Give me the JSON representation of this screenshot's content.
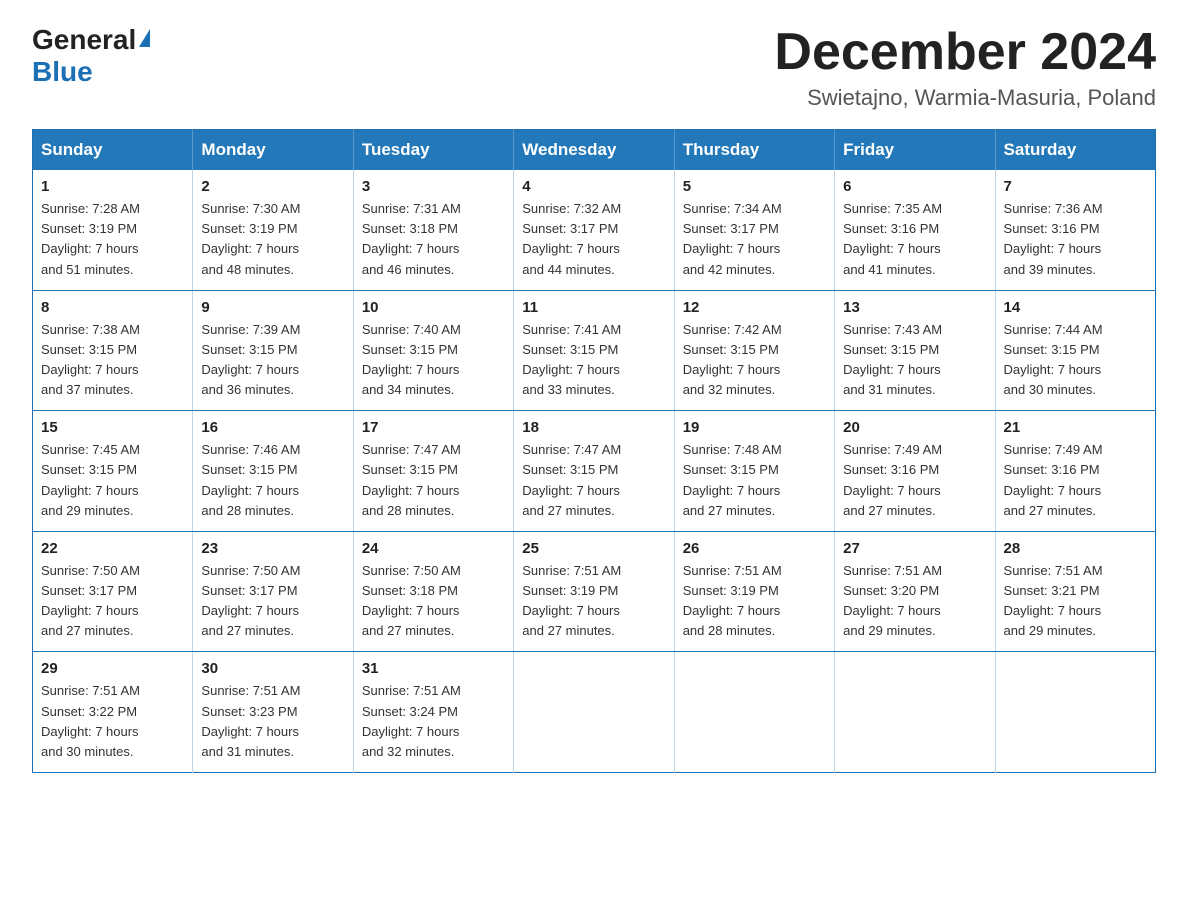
{
  "header": {
    "logo_general": "General",
    "logo_blue": "Blue",
    "month_title": "December 2024",
    "subtitle": "Swietajno, Warmia-Masuria, Poland"
  },
  "days_of_week": [
    "Sunday",
    "Monday",
    "Tuesday",
    "Wednesday",
    "Thursday",
    "Friday",
    "Saturday"
  ],
  "weeks": [
    [
      {
        "day": "1",
        "sunrise": "7:28 AM",
        "sunset": "3:19 PM",
        "daylight": "7 hours and 51 minutes."
      },
      {
        "day": "2",
        "sunrise": "7:30 AM",
        "sunset": "3:19 PM",
        "daylight": "7 hours and 48 minutes."
      },
      {
        "day": "3",
        "sunrise": "7:31 AM",
        "sunset": "3:18 PM",
        "daylight": "7 hours and 46 minutes."
      },
      {
        "day": "4",
        "sunrise": "7:32 AM",
        "sunset": "3:17 PM",
        "daylight": "7 hours and 44 minutes."
      },
      {
        "day": "5",
        "sunrise": "7:34 AM",
        "sunset": "3:17 PM",
        "daylight": "7 hours and 42 minutes."
      },
      {
        "day": "6",
        "sunrise": "7:35 AM",
        "sunset": "3:16 PM",
        "daylight": "7 hours and 41 minutes."
      },
      {
        "day": "7",
        "sunrise": "7:36 AM",
        "sunset": "3:16 PM",
        "daylight": "7 hours and 39 minutes."
      }
    ],
    [
      {
        "day": "8",
        "sunrise": "7:38 AM",
        "sunset": "3:15 PM",
        "daylight": "7 hours and 37 minutes."
      },
      {
        "day": "9",
        "sunrise": "7:39 AM",
        "sunset": "3:15 PM",
        "daylight": "7 hours and 36 minutes."
      },
      {
        "day": "10",
        "sunrise": "7:40 AM",
        "sunset": "3:15 PM",
        "daylight": "7 hours and 34 minutes."
      },
      {
        "day": "11",
        "sunrise": "7:41 AM",
        "sunset": "3:15 PM",
        "daylight": "7 hours and 33 minutes."
      },
      {
        "day": "12",
        "sunrise": "7:42 AM",
        "sunset": "3:15 PM",
        "daylight": "7 hours and 32 minutes."
      },
      {
        "day": "13",
        "sunrise": "7:43 AM",
        "sunset": "3:15 PM",
        "daylight": "7 hours and 31 minutes."
      },
      {
        "day": "14",
        "sunrise": "7:44 AM",
        "sunset": "3:15 PM",
        "daylight": "7 hours and 30 minutes."
      }
    ],
    [
      {
        "day": "15",
        "sunrise": "7:45 AM",
        "sunset": "3:15 PM",
        "daylight": "7 hours and 29 minutes."
      },
      {
        "day": "16",
        "sunrise": "7:46 AM",
        "sunset": "3:15 PM",
        "daylight": "7 hours and 28 minutes."
      },
      {
        "day": "17",
        "sunrise": "7:47 AM",
        "sunset": "3:15 PM",
        "daylight": "7 hours and 28 minutes."
      },
      {
        "day": "18",
        "sunrise": "7:47 AM",
        "sunset": "3:15 PM",
        "daylight": "7 hours and 27 minutes."
      },
      {
        "day": "19",
        "sunrise": "7:48 AM",
        "sunset": "3:15 PM",
        "daylight": "7 hours and 27 minutes."
      },
      {
        "day": "20",
        "sunrise": "7:49 AM",
        "sunset": "3:16 PM",
        "daylight": "7 hours and 27 minutes."
      },
      {
        "day": "21",
        "sunrise": "7:49 AM",
        "sunset": "3:16 PM",
        "daylight": "7 hours and 27 minutes."
      }
    ],
    [
      {
        "day": "22",
        "sunrise": "7:50 AM",
        "sunset": "3:17 PM",
        "daylight": "7 hours and 27 minutes."
      },
      {
        "day": "23",
        "sunrise": "7:50 AM",
        "sunset": "3:17 PM",
        "daylight": "7 hours and 27 minutes."
      },
      {
        "day": "24",
        "sunrise": "7:50 AM",
        "sunset": "3:18 PM",
        "daylight": "7 hours and 27 minutes."
      },
      {
        "day": "25",
        "sunrise": "7:51 AM",
        "sunset": "3:19 PM",
        "daylight": "7 hours and 27 minutes."
      },
      {
        "day": "26",
        "sunrise": "7:51 AM",
        "sunset": "3:19 PM",
        "daylight": "7 hours and 28 minutes."
      },
      {
        "day": "27",
        "sunrise": "7:51 AM",
        "sunset": "3:20 PM",
        "daylight": "7 hours and 29 minutes."
      },
      {
        "day": "28",
        "sunrise": "7:51 AM",
        "sunset": "3:21 PM",
        "daylight": "7 hours and 29 minutes."
      }
    ],
    [
      {
        "day": "29",
        "sunrise": "7:51 AM",
        "sunset": "3:22 PM",
        "daylight": "7 hours and 30 minutes."
      },
      {
        "day": "30",
        "sunrise": "7:51 AM",
        "sunset": "3:23 PM",
        "daylight": "7 hours and 31 minutes."
      },
      {
        "day": "31",
        "sunrise": "7:51 AM",
        "sunset": "3:24 PM",
        "daylight": "7 hours and 32 minutes."
      },
      null,
      null,
      null,
      null
    ]
  ],
  "labels": {
    "sunrise": "Sunrise:",
    "sunset": "Sunset:",
    "daylight": "Daylight:"
  }
}
